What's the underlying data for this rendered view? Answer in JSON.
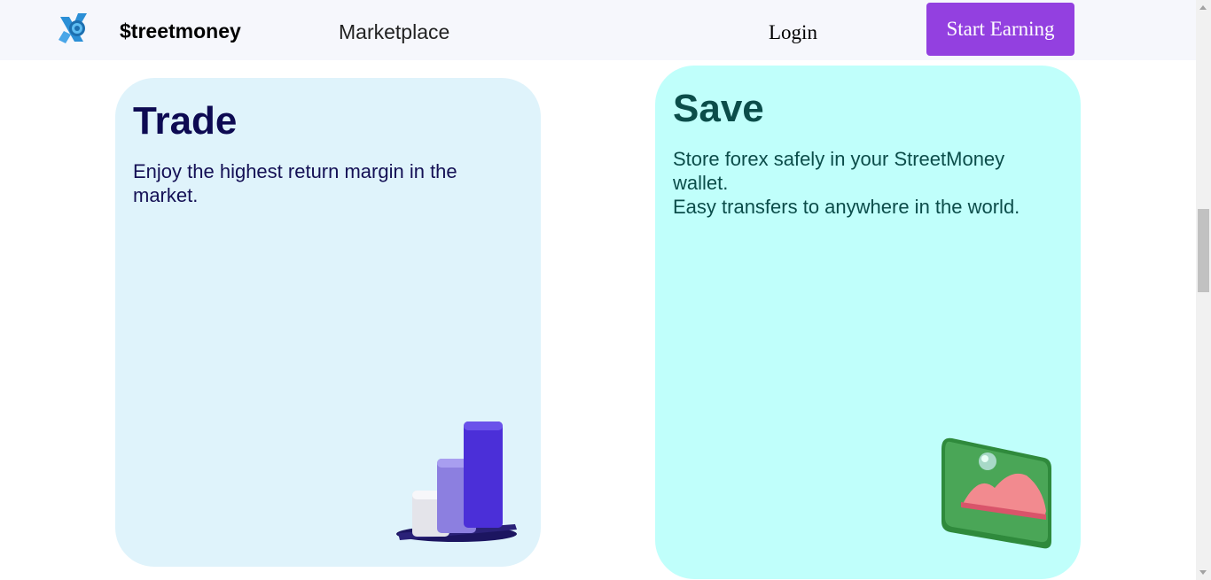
{
  "nav": {
    "brand": "$treetmoney",
    "marketplace": "Marketplace",
    "login": "Login",
    "cta": "Start Earning"
  },
  "cards": {
    "trade": {
      "title": "Trade",
      "text": "Enjoy the highest return margin in the market."
    },
    "save": {
      "title": "Save",
      "line1": "Store forex safely in your StreetMoney wallet.",
      "line2": "Easy transfers to anywhere in the world."
    }
  },
  "colors": {
    "accent": "#9340e0",
    "trade_bg": "#dff3fb",
    "save_bg": "#c0fffb",
    "trade_title": "#0d0a52",
    "save_title": "#0b4d4a"
  },
  "icons": {
    "logo": "streetmoney-logo-icon",
    "trade_illustration": "bar-chart-3d-icon",
    "save_illustration": "image-3d-icon"
  }
}
